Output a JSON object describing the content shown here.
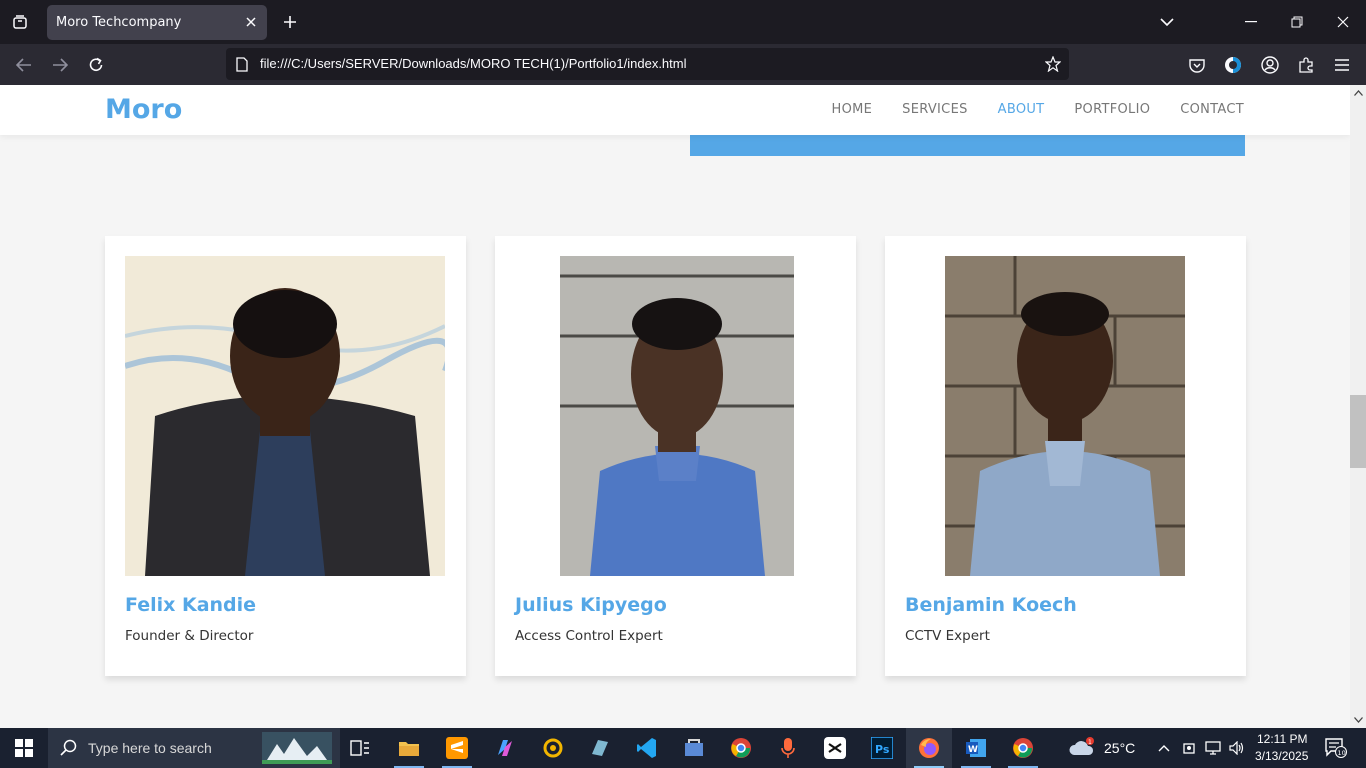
{
  "browser": {
    "tab_title": "Moro Techcompany",
    "url": "file:///C:/Users/SERVER/Downloads/MORO TECH(1)/Portfolio1/index.html"
  },
  "site": {
    "logo": "Moro",
    "brand_color": "#55a7e6",
    "nav": [
      {
        "label": "HOME",
        "active": false
      },
      {
        "label": "SERVICES",
        "active": false
      },
      {
        "label": "ABOUT",
        "active": true
      },
      {
        "label": "PORTFOLIO",
        "active": false
      },
      {
        "label": "CONTACT",
        "active": false
      }
    ]
  },
  "team": [
    {
      "name": "Felix Kandie",
      "role": "Founder & Director"
    },
    {
      "name": "Julius Kipyego",
      "role": "Access Control Expert"
    },
    {
      "name": "Benjamin Koech",
      "role": "CCTV Expert"
    }
  ],
  "taskbar": {
    "search_placeholder": "Type here to search",
    "weather": "25°C",
    "weather_badge": "1",
    "time": "12:11 PM",
    "date": "3/13/2025",
    "notifications": "10"
  }
}
